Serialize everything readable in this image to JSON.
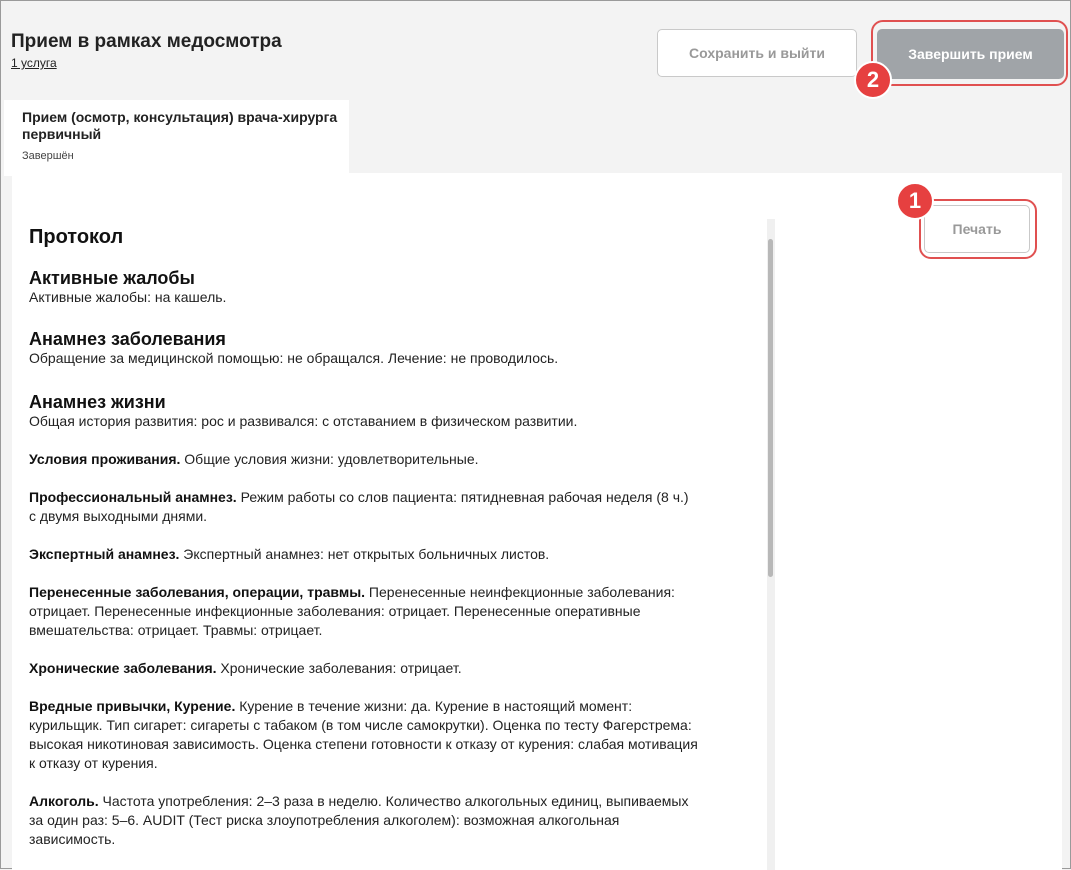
{
  "header": {
    "title": "Прием в рамках медосмотра",
    "services_link": "1 услуга",
    "save_label": "Сохранить и выйти",
    "finish_label": "Завершить прием"
  },
  "callouts": {
    "one": "1",
    "two": "2"
  },
  "tab": {
    "title": "Прием (осмотр, консультация) врача-хирурга первичный",
    "status": "Завершён"
  },
  "print_label": "Печать",
  "protocol": {
    "heading": "Протокол",
    "complaints": {
      "title": "Активные жалобы",
      "text": "Активные жалобы: на кашель."
    },
    "disease_history": {
      "title": "Анамнез заболевания",
      "text": "Обращение за медицинской помощью: не обращался. Лечение: не проводилось."
    },
    "life_history": {
      "title": "Анамнез жизни",
      "text": "Общая история развития: рос и развивался: с отставанием в физическом развитии."
    },
    "items": [
      {
        "label": "Условия проживания.",
        "text": " Общие условия жизни: удовлетворительные."
      },
      {
        "label": "Профессиональный анамнез.",
        "text": " Режим работы со слов пациента: пятидневная рабочая неделя (8 ч.) с двумя выходными днями."
      },
      {
        "label": "Экспертный анамнез.",
        "text": " Экспертный анамнез: нет открытых больничных листов."
      },
      {
        "label": "Перенесенные заболевания, операции, травмы.",
        "text": " Перенесенные неинфекционные заболевания: отрицает. Перенесенные инфекционные заболевания: отрицает. Перенесенные оперативные вмешательства: отрицает. Травмы: отрицает."
      },
      {
        "label": "Хронические заболевания.",
        "text": " Хронические заболевания: отрицает."
      },
      {
        "label": "Вредные привычки, Курение.",
        "text": " Курение в течение жизни: да. Курение в настоящий момент: курильщик. Тип сигарет: сигареты с табаком (в том числе самокрутки). Оценка по тесту Фагерстрема: высокая никотиновая зависимость. Оценка степени готовности к отказу от курения: слабая мотивация к отказу от курения."
      },
      {
        "label": "Алкоголь.",
        "text": " Частота употребления: 2–3 раза в неделю. Количество алкогольных единиц, выпиваемых за один раз: 5–6. AUDIT (Тест риска злоупотребления алкоголем): возможная алкогольная зависимость."
      }
    ]
  }
}
